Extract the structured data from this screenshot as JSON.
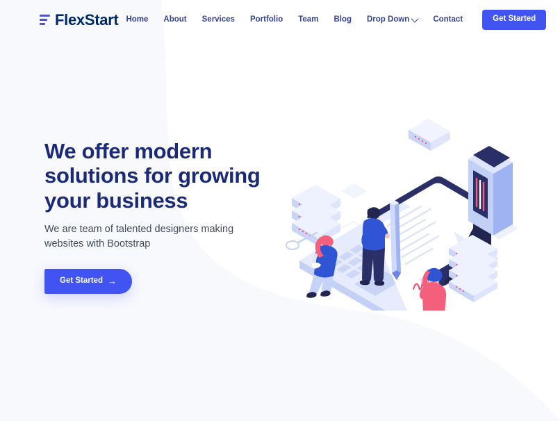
{
  "brand": {
    "name": "FlexStart",
    "logo_icon": "three-bars-icon",
    "accent_color": "#4154f1",
    "heading_color": "#1b2a78"
  },
  "header": {
    "nav_items": [
      {
        "label": "Home",
        "active": true,
        "has_dropdown": false
      },
      {
        "label": "About",
        "active": false,
        "has_dropdown": false
      },
      {
        "label": "Services",
        "active": false,
        "has_dropdown": false
      },
      {
        "label": "Portfolio",
        "active": false,
        "has_dropdown": false
      },
      {
        "label": "Team",
        "active": false,
        "has_dropdown": false
      },
      {
        "label": "Blog",
        "active": false,
        "has_dropdown": false
      },
      {
        "label": "Drop Down",
        "active": false,
        "has_dropdown": true
      },
      {
        "label": "Contact",
        "active": false,
        "has_dropdown": false
      }
    ],
    "cta_label": "Get Started"
  },
  "hero": {
    "title_line_1": "We offer modern",
    "title_line_2": "solutions for growing",
    "title_line_3": "your business",
    "subtitle": "We are team of talented designers making websites with Bootstrap",
    "cta_label": "Get Started",
    "cta_arrow": "→",
    "illustration_name": "isometric-document-signing-illustration"
  },
  "palette": {
    "page_background": "#f8f9fc",
    "overlay_white": "#ffffff",
    "nav_text": "#35449b",
    "body_text": "#444b5e",
    "illustration_navy": "#2b2f68",
    "illustration_blue": "#2f55d4",
    "illustration_light_blue": "#b9c6f5",
    "illustration_pale": "#dfe6fb",
    "illustration_pink": "#f4607c"
  }
}
